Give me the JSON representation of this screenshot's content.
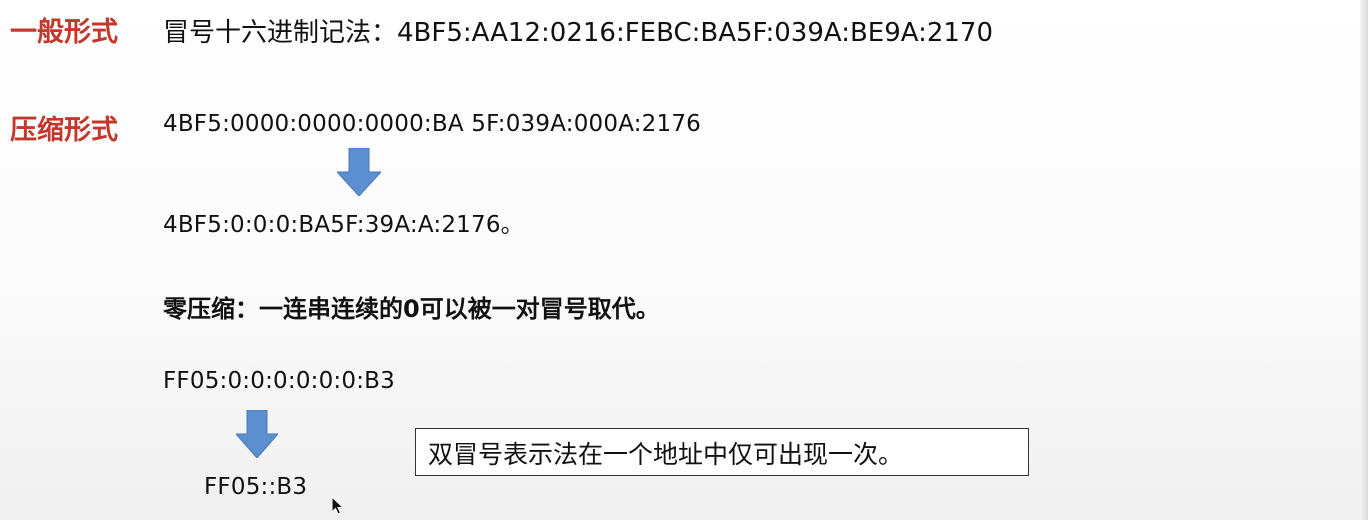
{
  "general": {
    "label": "一般形式",
    "text": "冒号十六进制记法：4BF5:AA12:0216:FEBC:BA5F:039A:BE9A:2170"
  },
  "compressed": {
    "label": "压缩形式",
    "original": "4BF5:0000:0000:0000:BA 5F:039A:000A:2176",
    "result": "4BF5:0:0:0:BA5F:39A:A:2176。"
  },
  "zero_compression": {
    "heading": "零压缩：一连串连续的0可以被一对冒号取代。",
    "original": "FF05:0:0:0:0:0:0:B3",
    "result": "FF05::B3",
    "note": "双冒号表示法在一个地址中仅可出现一次。"
  },
  "colors": {
    "label": "#c0392b",
    "arrow": "#5b8fd0"
  },
  "icons": [
    "down-arrow-icon",
    "mouse-cursor-icon"
  ]
}
